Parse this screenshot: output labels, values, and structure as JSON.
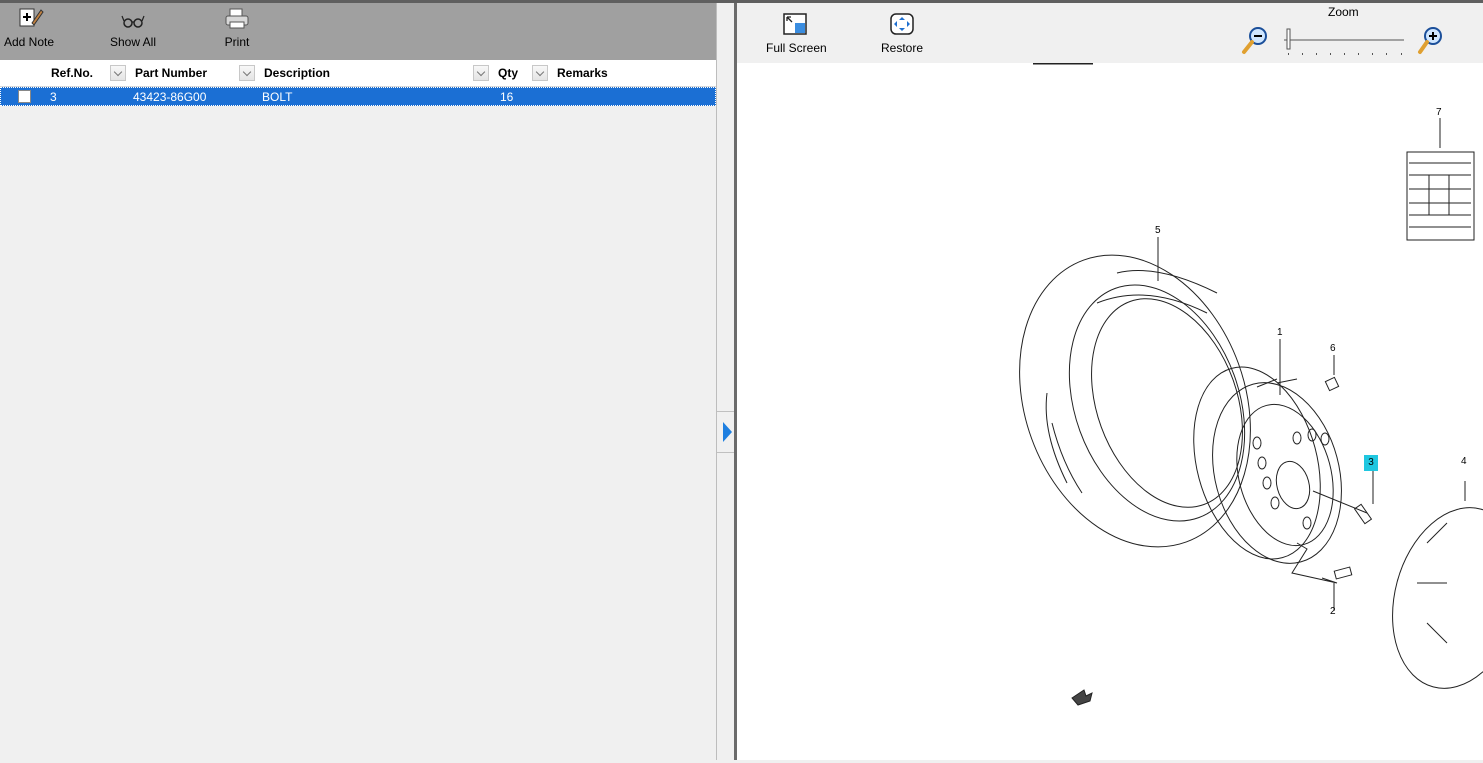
{
  "left_toolbar": {
    "add_note": "Add Note",
    "show_all": "Show All",
    "print": "Print"
  },
  "grid": {
    "columns": [
      "Ref.No.",
      "Part Number",
      "Description",
      "Qty",
      "Remarks"
    ],
    "rows": [
      {
        "ref": "3",
        "part_number": "43423-86G00",
        "description": "BOLT",
        "qty": "16",
        "remarks": ""
      }
    ]
  },
  "right_toolbar": {
    "full_screen": "Full Screen",
    "restore": "Restore",
    "zoom_label": "Zoom",
    "zoom_level": 0
  },
  "diagram": {
    "callouts": [
      "1",
      "2",
      "3",
      "4",
      "5",
      "6",
      "7"
    ],
    "highlighted_callout": "3"
  },
  "colors": {
    "selection": "#1b6fd4",
    "highlight": "#1fc7e0",
    "toolbar": "#a0a0a0"
  }
}
